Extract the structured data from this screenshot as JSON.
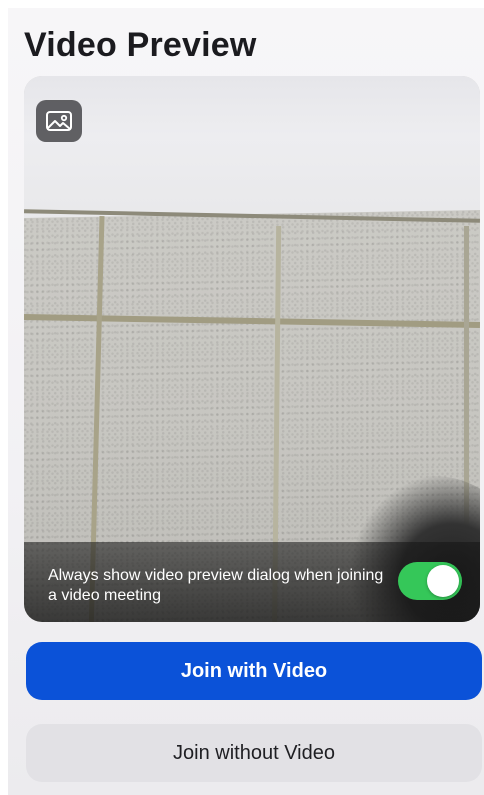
{
  "header": {
    "title": "Video Preview"
  },
  "preview": {
    "background_icon": "image-icon",
    "caption": "Always show video preview dialog when joining a video meeting",
    "toggle_on": true
  },
  "actions": {
    "join_with_video": "Join with Video",
    "join_without_video": "Join without Video"
  },
  "colors": {
    "primary": "#0b52d8",
    "toggle_on": "#35c759",
    "secondary_button": "#e2e1e5"
  }
}
